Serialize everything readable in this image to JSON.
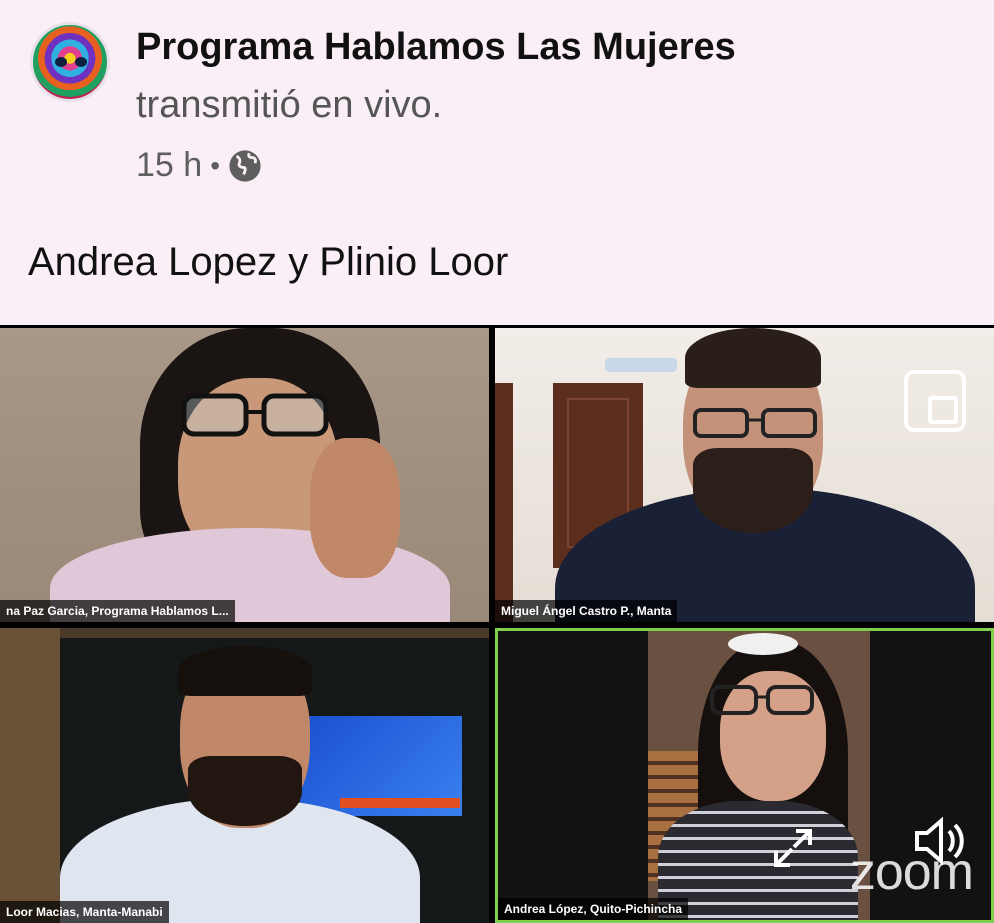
{
  "post": {
    "page_name": "Programa Hablamos Las Mujeres",
    "action": "transmitió en vivo.",
    "time": "15 h",
    "separator": "•",
    "privacy_icon": "globe-icon",
    "text": "Andrea Lopez y Plinio Loor"
  },
  "video": {
    "participants": [
      {
        "label": "na Paz Garcia, Programa Hablamos L..."
      },
      {
        "label": "Miguel Ángel Castro P., Manta"
      },
      {
        "label": "Loor Macias, Manta-Manabi"
      },
      {
        "label": "Andrea López, Quito-Pichincha"
      }
    ],
    "watermark": "zoom",
    "active_speaker_color": "#7ed04a"
  }
}
